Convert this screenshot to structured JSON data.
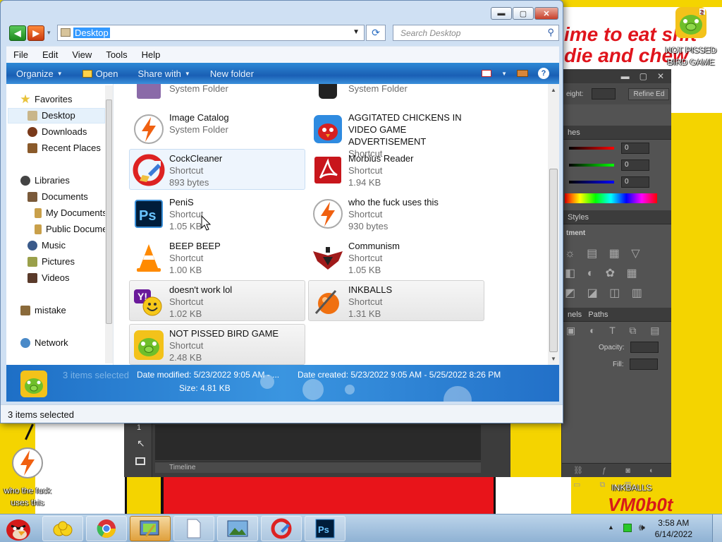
{
  "desktop": {
    "bg_text_line1": "ime to eat shit",
    "bg_text_line2": "die and chew",
    "vm_text": "VM0b0t",
    "icons": [
      {
        "label": "NOT PISSED BIRD GAME",
        "icon": "angry-birds-pig-icon"
      },
      {
        "label": "who the fuck uses this",
        "icon": "lightning-icon"
      },
      {
        "label": "INKBALLS",
        "icon": "inkball-icon"
      }
    ]
  },
  "photoshop": {
    "height_label": "eight:",
    "refine_label": "Refine Ed",
    "swatches_tab": "hes",
    "rgb": [
      "0",
      "0",
      "0"
    ],
    "styles_tab": "Styles",
    "adjustments_label": "tment",
    "channels_tab": "nels",
    "paths_tab": "Paths",
    "opacity_label": "Opacity:",
    "fill_label": "Fill:",
    "timeline_label": "Timeline",
    "toolbox_num": "1"
  },
  "window": {
    "address": "Desktop",
    "search_placeholder": "Search Desktop",
    "menu": [
      "File",
      "Edit",
      "View",
      "Tools",
      "Help"
    ],
    "commands": {
      "organize": "Organize",
      "open": "Open",
      "share": "Share with",
      "new_folder": "New folder"
    },
    "nav": {
      "favorites": "Favorites",
      "desktop": "Desktop",
      "downloads": "Downloads",
      "recent": "Recent Places",
      "libraries": "Libraries",
      "documents": "Documents",
      "my_documents": "My Documents",
      "public_documents": "Public Documents",
      "music": "Music",
      "pictures": "Pictures",
      "videos": "Videos",
      "mistake": "mistake",
      "network": "Network"
    },
    "items": [
      {
        "name": "",
        "line2": "System Folder",
        "line3": "",
        "icon": "folder-partial-icon"
      },
      {
        "name": "",
        "line2": "System Folder",
        "line3": "",
        "icon": "user-partial-icon"
      },
      {
        "name": "Image Catalog",
        "line2": "System Folder",
        "line3": "",
        "icon": "lightning-icon"
      },
      {
        "name": "AGGITATED CHICKENS IN VIDEO GAME ADVERTISEMENT",
        "line2": "Shortcut",
        "line3": "",
        "icon": "angry-birds-rio-icon"
      },
      {
        "name": "CockCleaner",
        "line2": "Shortcut",
        "line3": "893 bytes",
        "icon": "ccleaner-icon"
      },
      {
        "name": "Morbius Reader",
        "line2": "Shortcut",
        "line3": "1.94 KB",
        "icon": "pdf-reader-icon"
      },
      {
        "name": "PeniS",
        "line2": "Shortcut",
        "line3": "1.05 KB",
        "icon": "photoshop-icon"
      },
      {
        "name": "who the fuck uses this",
        "line2": "Shortcut",
        "line3": "930 bytes",
        "icon": "lightning-icon"
      },
      {
        "name": "BEEP BEEP",
        "line2": "Shortcut",
        "line3": "1.00 KB",
        "icon": "vlc-cone-icon"
      },
      {
        "name": "Communism",
        "line2": "Shortcut",
        "line3": "1.05 KB",
        "icon": "communism-emblem-icon"
      },
      {
        "name": "doesn't work lol",
        "line2": "Shortcut",
        "line3": "1.02 KB",
        "icon": "yahoo-messenger-icon"
      },
      {
        "name": "INKBALLS",
        "line2": "Shortcut",
        "line3": "1.31 KB",
        "icon": "inkball-icon"
      },
      {
        "name": "NOT PISSED BIRD GAME",
        "line2": "Shortcut",
        "line3": "2.48 KB",
        "icon": "angry-birds-pig-icon"
      }
    ],
    "details": {
      "selected": "3 items selected",
      "modified": "Date modified: 5/23/2022 9:05 AM - ...",
      "created": "Date created: 5/23/2022 9:05 AM - 5/25/2022 8:26 PM",
      "size": "Size: 4.81 KB"
    },
    "status": "3 items selected"
  },
  "taskbar": {
    "time": "3:58 AM",
    "date": "6/14/2022",
    "buttons": [
      "angry-birds-start-icon",
      "yellow-birds-icon",
      "chrome-icon",
      "desktop-shortcut-icon",
      "blank-document-icon",
      "image-viewer-icon",
      "ccleaner-icon",
      "photoshop-icon"
    ]
  }
}
